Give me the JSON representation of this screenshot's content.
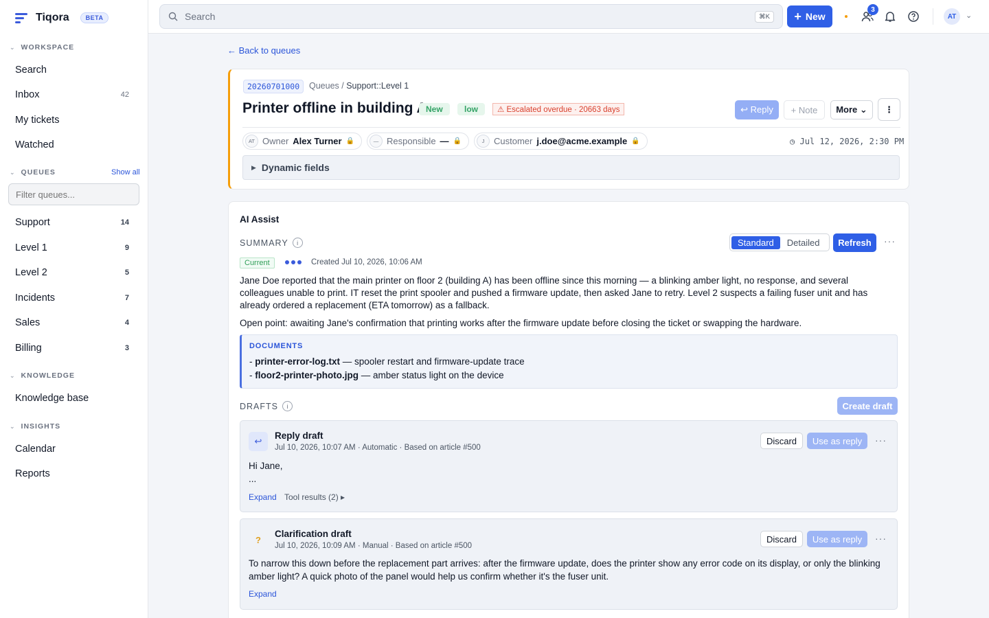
{
  "app": {
    "name": "Tiqora",
    "badge": "BETA"
  },
  "sidebar": {
    "workspace": {
      "title": "WORKSPACE",
      "items": [
        {
          "label": "Search"
        },
        {
          "label": "Inbox",
          "count": "42"
        },
        {
          "label": "My tickets"
        },
        {
          "label": "Watched"
        }
      ]
    },
    "queues": {
      "title": "QUEUES",
      "show_all": "Show all",
      "filter_placeholder": "Filter queues...",
      "items": [
        {
          "label": "Support",
          "count": "14"
        },
        {
          "label": "Level 1",
          "count": "9"
        },
        {
          "label": "Level 2",
          "count": "5"
        },
        {
          "label": "Incidents",
          "count": "7"
        },
        {
          "label": "Sales",
          "count": "4"
        },
        {
          "label": "Billing",
          "count": "3"
        }
      ]
    },
    "knowledge": {
      "title": "KNOWLEDGE",
      "items": [
        {
          "label": "Knowledge base"
        }
      ]
    },
    "insights": {
      "title": "INSIGHTS",
      "items": [
        {
          "label": "Calendar"
        },
        {
          "label": "Reports"
        }
      ]
    }
  },
  "topbar": {
    "search_placeholder": "Search",
    "shortcut": "⌘K",
    "new_label": "New",
    "notif_count": "3",
    "user_initials": "AT"
  },
  "ticket": {
    "back": "← Back to queues",
    "number": "20260701000",
    "breadcrumb_root": "Queues",
    "breadcrumb_path": "Support::Level 1",
    "title": "Printer offline in building A",
    "state": "New",
    "priority": "low",
    "escalation": "⚠ Escalated overdue · 20663 days",
    "actions": {
      "reply": "↩ Reply",
      "note": "+ Note",
      "more": "More ⌄",
      "kebab": "⋮"
    },
    "owner": {
      "initials": "AT",
      "label": "Owner",
      "value": "Alex Turner"
    },
    "responsible": {
      "initials": "—",
      "label": "Responsible",
      "value": "—"
    },
    "customer": {
      "initials": "J",
      "label": "Customer",
      "value": "j.doe@acme.example"
    },
    "lock": "🔒",
    "date": "Jul 12, 2026, 2:30 PM",
    "dynamic_fields": "Dynamic fields"
  },
  "ai": {
    "title": "AI Assist",
    "summary_label": "SUMMARY",
    "modes": {
      "standard": "Standard",
      "detailed": "Detailed"
    },
    "refresh": "Refresh",
    "current": "Current",
    "created": "Created Jul 10, 2026, 10:06 AM",
    "summary": "Jane Doe reported that the main printer on floor 2 (building A) has been offline since this morning — a blinking amber light, no response, and several colleagues unable to print. IT reset the print spooler and pushed a firmware update, then asked Jane to retry. Level 2 suspects a failing fuser unit and has already ordered a replacement (ETA tomorrow) as a fallback.",
    "open_point": "Open point: awaiting Jane's confirmation that printing works after the firmware update before closing the ticket or swapping the hardware.",
    "documents": {
      "title": "DOCUMENTS",
      "items": [
        {
          "name": "printer-error-log.txt",
          "desc": " — spooler restart and firmware-update trace"
        },
        {
          "name": "floor2-printer-photo.jpg",
          "desc": " — amber status light on the device"
        }
      ]
    },
    "drafts_label": "DRAFTS",
    "create_draft": "Create draft",
    "drafts": [
      {
        "title": "Reply draft",
        "meta": "Jul 10, 2026, 10:07 AM · Automatic · Based on article #500",
        "body_line1": "Hi Jane,",
        "body_line2": "...",
        "discard": "Discard",
        "use": "Use as reply",
        "expand": "Expand",
        "tool_results": "Tool results (2) ▸"
      },
      {
        "title": "Clarification draft",
        "meta": "Jul 10, 2026, 10:09 AM · Manual · Based on article #500",
        "body": "To narrow this down before the replacement part arrives: after the firmware update, does the printer show any error code on its display, or only the blinking amber light? A quick photo of the panel would help us confirm whether it's the fuser unit.",
        "discard": "Discard",
        "use": "Use as reply",
        "expand": "Expand"
      }
    ]
  },
  "colors": {
    "accent": "#2f5fe6",
    "warning": "#f59e0b",
    "success": "#34a366",
    "danger": "#d9412e"
  },
  "icons": [
    "app-logo-icon",
    "search-icon",
    "plus-icon",
    "users-icon",
    "bell-icon",
    "help-icon",
    "chevron-down-icon",
    "info-icon",
    "reply-icon",
    "question-icon",
    "ellipsis-icon",
    "lock-icon",
    "clock-icon",
    "triangle-right-icon"
  ]
}
